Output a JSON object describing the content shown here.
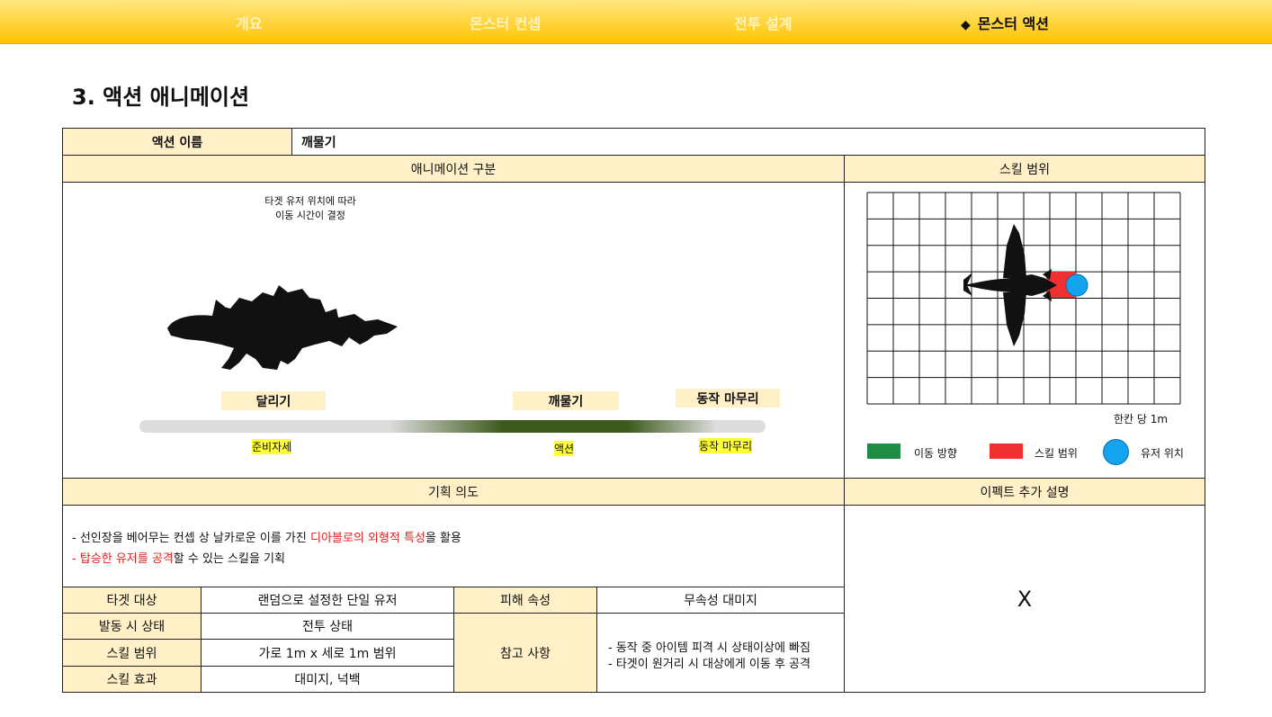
{
  "nav": {
    "tabs": [
      "개요",
      "몬스터 컨셉",
      "전투 설계",
      "몬스터 액션"
    ],
    "active_marker": "◆"
  },
  "page_title": "3. 액션 애니메이션",
  "action": {
    "name_label": "액션 이름",
    "name_value": "깨물기"
  },
  "animation": {
    "header": "애니메이션 구분",
    "note_line1": "타겟 유저 위치에 따라",
    "note_line2": "이동 시간이 결정",
    "phases": [
      "달리기",
      "깨물기",
      "동작 마무리"
    ],
    "timeline_labels": [
      "준비자세",
      "액션",
      "동작 마무리"
    ],
    "timeline_color": "#3d5a1c"
  },
  "skill_range": {
    "header": "스킬 범위",
    "scale_note": "한칸 당 1m",
    "legend": [
      {
        "label": "이동 방향",
        "color": "#1e8c45"
      },
      {
        "label": "스킬 범위",
        "color": "#f03030"
      },
      {
        "label": "유저 위치",
        "color": "#14a4ef"
      }
    ]
  },
  "intent": {
    "header": "기획 의도",
    "line1_pre": "- 선인장을 베어무는 컨셉 상 날카로운 이를 가진 ",
    "line1_red": "디아블로의 외형적 특성",
    "line1_post": "을 활용",
    "line2_dash": "- ",
    "line2_red": "탑승한 유저를 공격",
    "line2_post": "할 수 있는 스킬을 기획"
  },
  "effect": {
    "header": "이펙트 추가 설명",
    "value": "X"
  },
  "specs": {
    "target_label": "타겟 대상",
    "target_value": "랜덤으로 설정한 단일 유저",
    "damage_label": "피해 속성",
    "damage_value": "무속성 대미지",
    "state_label": "발동 시 상태",
    "state_value": "전투 상태",
    "range_label": "스킬 범위",
    "range_value": "가로 1m x 세로 1m 범위",
    "effect_label": "스킬 효과",
    "effect_value": "대미지, 넉백",
    "ref_label": "참고 사항",
    "ref_line1": "- 동작 중 아이템 피격 시 상태이상에 빠짐",
    "ref_line2": "- 타겟이 원거리 시 대상에게 이동 후 공격"
  }
}
